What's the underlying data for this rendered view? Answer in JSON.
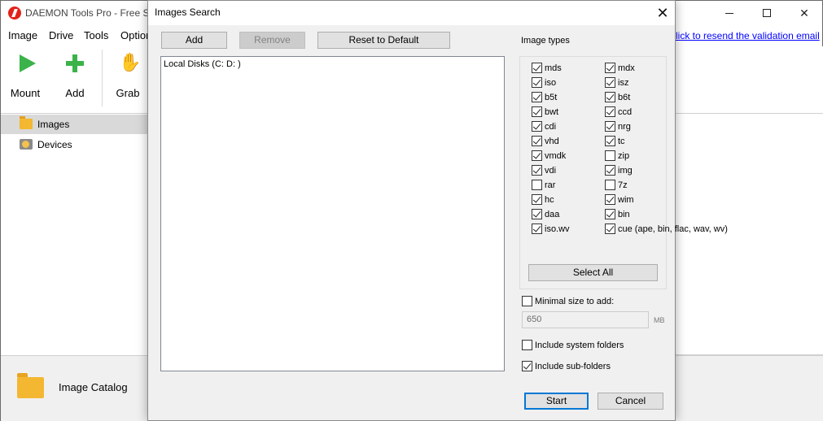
{
  "main_window": {
    "title": "DAEMON Tools Pro - Free Su",
    "menu": {
      "image": "Image",
      "drive": "Drive",
      "tools": "Tools",
      "options": "Option"
    },
    "validation_link": "lick to resend the validation email",
    "toolbar": {
      "mount": "Mount",
      "add": "Add",
      "grab": "Grab"
    },
    "sidebar": {
      "images": "Images",
      "devices": "Devices"
    },
    "catalog_label": "Image Catalog",
    "window_controls": {
      "close": "✕"
    }
  },
  "dialog": {
    "title": "Images Search",
    "close_glyph": "✕",
    "buttons": {
      "add": "Add",
      "remove": "Remove",
      "reset": "Reset to Default",
      "select_all": "Select All",
      "start": "Start",
      "cancel": "Cancel"
    },
    "locations": [
      "Local Disks (C: D: )"
    ],
    "image_types_label": "Image types",
    "image_types": [
      {
        "label": "mds",
        "checked": true
      },
      {
        "label": "mdx",
        "checked": true
      },
      {
        "label": "iso",
        "checked": true
      },
      {
        "label": "isz",
        "checked": true
      },
      {
        "label": "b5t",
        "checked": true
      },
      {
        "label": "b6t",
        "checked": true
      },
      {
        "label": "bwt",
        "checked": true
      },
      {
        "label": "ccd",
        "checked": true
      },
      {
        "label": "cdi",
        "checked": true
      },
      {
        "label": "nrg",
        "checked": true
      },
      {
        "label": "vhd",
        "checked": true
      },
      {
        "label": "tc",
        "checked": true
      },
      {
        "label": "vmdk",
        "checked": true
      },
      {
        "label": "zip",
        "checked": false
      },
      {
        "label": "vdi",
        "checked": true
      },
      {
        "label": "img",
        "checked": true
      },
      {
        "label": "rar",
        "checked": false
      },
      {
        "label": "7z",
        "checked": false
      },
      {
        "label": "hc",
        "checked": true
      },
      {
        "label": "wim",
        "checked": true
      },
      {
        "label": "daa",
        "checked": true
      },
      {
        "label": "bin",
        "checked": true
      },
      {
        "label": "iso.wv",
        "checked": true
      },
      {
        "label": "cue (ape, bin, flac, wav, wv)",
        "checked": true
      }
    ],
    "minimal_size": {
      "label": "Minimal size to add:",
      "checked": false,
      "value": "650",
      "unit": "MB"
    },
    "include_system": {
      "label": "Include system folders",
      "checked": false
    },
    "include_sub": {
      "label": "Include sub-folders",
      "checked": true
    }
  }
}
